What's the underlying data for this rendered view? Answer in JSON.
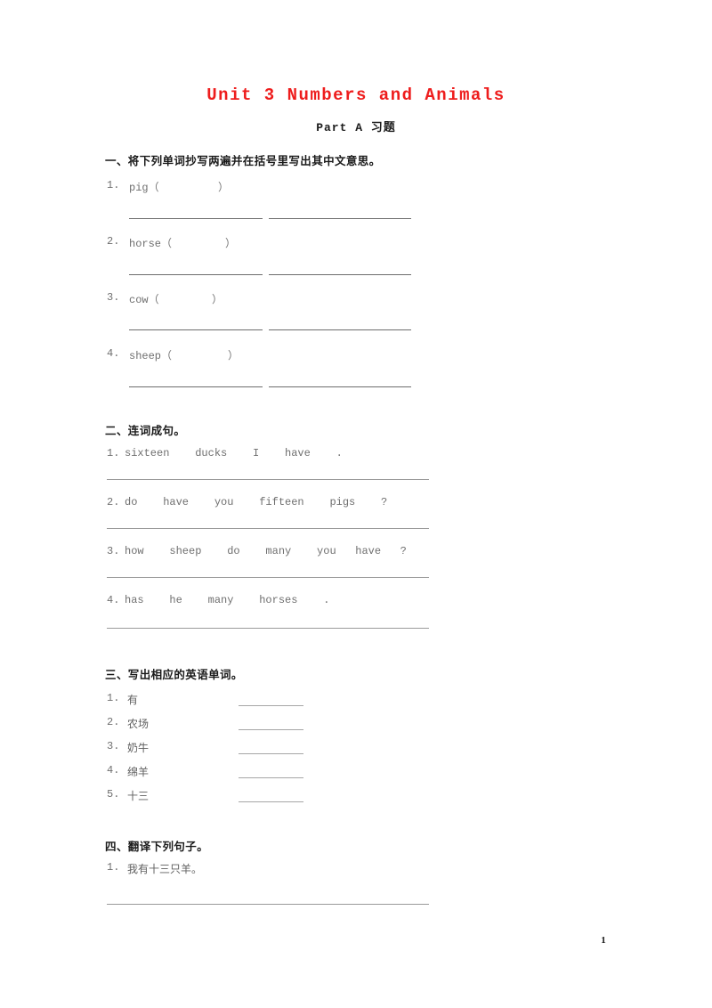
{
  "document": {
    "title": "Unit 3 Numbers and Animals",
    "subtitle": "Part A 习题",
    "title_color": "#ee1d1d",
    "page_number": "1"
  },
  "sections": [
    {
      "heading": "一、将下列单词抄写两遍并在括号里写出其中文意思。",
      "items": [
        {
          "number": "1.",
          "word": "pig（",
          "close": "）"
        },
        {
          "number": "2.",
          "word": "horse（",
          "close": "）"
        },
        {
          "number": "3.",
          "word": "cow（",
          "close": "）"
        },
        {
          "number": "4.",
          "word": "sheep（",
          "close": "）"
        }
      ]
    },
    {
      "heading": "二、连词成句。",
      "items": [
        {
          "number": "1.",
          "text": "sixteen    ducks    I    have    ."
        },
        {
          "number": "2.",
          "text": "do    have    you    fifteen    pigs    ?"
        },
        {
          "number": "3.",
          "text": "how    sheep    do    many    you   have   ?"
        },
        {
          "number": "4.",
          "text": "has    he    many    horses    ."
        }
      ]
    },
    {
      "heading": "三、写出相应的英语单词。",
      "items": [
        {
          "number": "1.",
          "text": "有"
        },
        {
          "number": "2.",
          "text": "农场"
        },
        {
          "number": "3.",
          "text": "奶牛"
        },
        {
          "number": "4.",
          "text": "绵羊"
        },
        {
          "number": "5.",
          "text": "十三"
        }
      ]
    },
    {
      "heading": "四、翻译下列句子。",
      "items": [
        {
          "number": "1.",
          "text": "我有十三只羊。"
        }
      ]
    }
  ]
}
